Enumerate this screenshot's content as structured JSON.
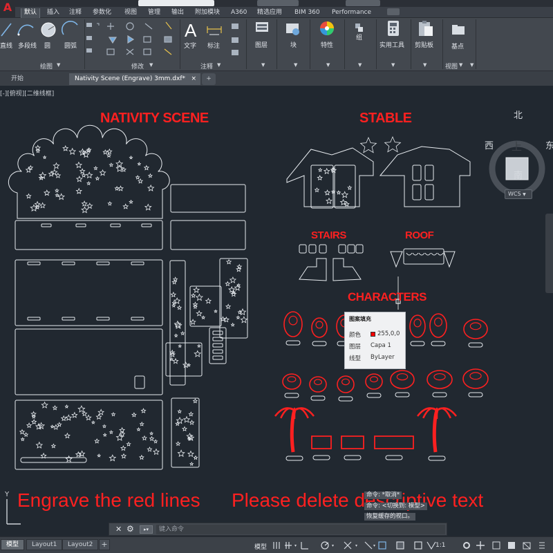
{
  "app": {
    "logo": "A"
  },
  "ribbon_tabs": [
    "默认",
    "插入",
    "注释",
    "参数化",
    "视图",
    "管理",
    "输出",
    "附加模块",
    "A360",
    "精选应用",
    "BIM 360",
    "Performance"
  ],
  "ribbon": {
    "draw_tools": [
      "直线",
      "多段线",
      "圆",
      "圆弧"
    ],
    "panels": [
      "绘图",
      "修改",
      "注释",
      "视图"
    ],
    "annotation_tools": [
      "文字",
      "标注"
    ],
    "big_buttons": [
      "图层",
      "块",
      "特性",
      "组",
      "实用工具",
      "剪贴板",
      "基点"
    ]
  },
  "doc_tabs": {
    "start": "开始",
    "file": "Nativity Scene (Engrave) 3mm.dxf*",
    "close": "×",
    "add": "+"
  },
  "viewport": {
    "label": "[-][俯视][二维线框]",
    "viewcube": {
      "north": "北",
      "south": "南",
      "west": "西",
      "east": "东",
      "face": "上",
      "wcs": "WCS"
    }
  },
  "drawing": {
    "headings": {
      "nativity": "NATIVITY SCENE",
      "stable": "STABLE",
      "stairs": "STAIRS",
      "roof": "ROOF",
      "characters": "CHARACTERS"
    },
    "footer_left": "Engrave the red lines",
    "footer_right": "Please delete descriptive text",
    "line_color": "#e8ecf0",
    "engrave_color": "#ff2020"
  },
  "tooltip": {
    "title": "图案填充",
    "rows": [
      {
        "key": "颜色",
        "value": "255,0,0"
      },
      {
        "key": "图层",
        "value": "Capa 1"
      },
      {
        "key": "线型",
        "value": "ByLayer"
      }
    ],
    "swatch_color": "#ff0000"
  },
  "command_history": [
    "命令: *取消*",
    "命令: <切换到: 模型>",
    "恢复缓存的视口。"
  ],
  "command_line": {
    "placeholder": "键入命令"
  },
  "status_bar": {
    "layout_tabs": [
      "模型",
      "Layout1",
      "Layout2"
    ],
    "model_label": "模型",
    "scale": "1:1"
  }
}
